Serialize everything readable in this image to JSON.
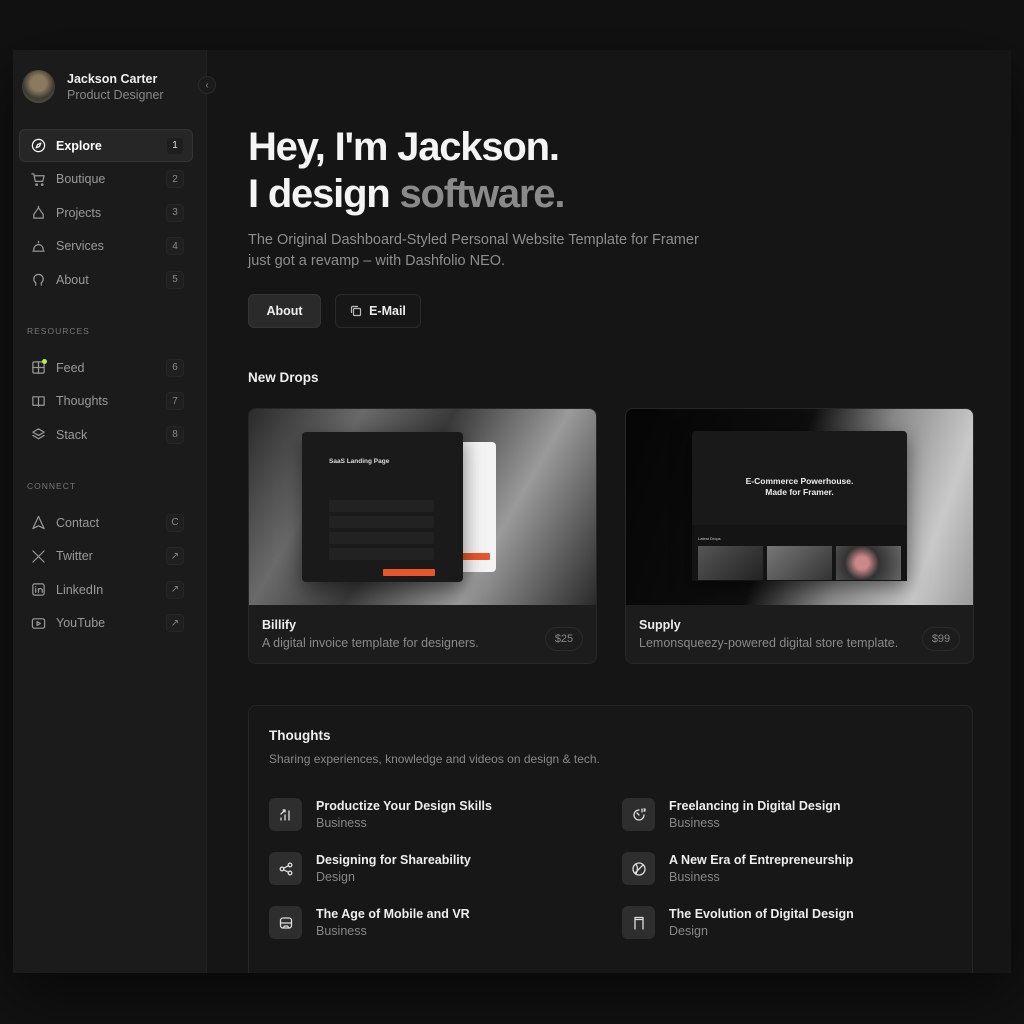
{
  "profile": {
    "name": "Jackson Carter",
    "role": "Product Designer"
  },
  "nav": [
    {
      "label": "Explore",
      "key": "1",
      "icon": "compass-icon",
      "active": true
    },
    {
      "label": "Boutique",
      "key": "2",
      "icon": "cart-icon"
    },
    {
      "label": "Projects",
      "key": "3",
      "icon": "projects-icon"
    },
    {
      "label": "Services",
      "key": "4",
      "icon": "bell-icon"
    },
    {
      "label": "About",
      "key": "5",
      "icon": "about-icon"
    }
  ],
  "resources_label": "RESOURCES",
  "resources": [
    {
      "label": "Feed",
      "key": "6",
      "icon": "feed-icon"
    },
    {
      "label": "Thoughts",
      "key": "7",
      "icon": "book-icon"
    },
    {
      "label": "Stack",
      "key": "8",
      "icon": "layers-icon"
    }
  ],
  "connect_label": "CONNECT",
  "connect": [
    {
      "label": "Contact",
      "key": "C",
      "icon": "send-icon"
    },
    {
      "label": "Twitter",
      "key": "↗",
      "icon": "x-icon"
    },
    {
      "label": "LinkedIn",
      "key": "↗",
      "icon": "linkedin-icon"
    },
    {
      "label": "YouTube",
      "key": "↗",
      "icon": "youtube-icon"
    }
  ],
  "hero": {
    "line1": "Hey, I'm Jackson.",
    "line2a": "I design ",
    "line2b": "software.",
    "subtitle": "The Original Dashboard-Styled Personal Website Template for Framer just got a revamp – with Dashfolio NEO.",
    "about_btn": "About",
    "email_btn": "E-Mail"
  },
  "drops": {
    "title": "New Drops",
    "items": [
      {
        "title": "Billify",
        "desc": "A digital invoice template for designers.",
        "price": "$25",
        "mock_title": "SaaS Landing Page"
      },
      {
        "title": "Supply",
        "desc": "Lemonsqueezy-powered digital store template.",
        "price": "$99",
        "mock_title1": "E-Commerce Powerhouse.",
        "mock_title2": "Made for Framer.",
        "mock_section": "Latest Drops"
      }
    ]
  },
  "thoughts": {
    "title": "Thoughts",
    "subtitle": "Sharing experiences, knowledge and videos on design & tech.",
    "items": [
      {
        "title": "Productize Your Design Skills",
        "category": "Business",
        "icon": "chart-icon"
      },
      {
        "title": "Freelancing in Digital Design",
        "category": "Business",
        "icon": "timer-icon"
      },
      {
        "title": "Designing for Shareability",
        "category": "Design",
        "icon": "share-icon"
      },
      {
        "title": "A New Era of Entrepreneurship",
        "category": "Business",
        "icon": "ball-icon"
      },
      {
        "title": "The Age of Mobile and VR",
        "category": "Business",
        "icon": "vr-icon"
      },
      {
        "title": "The Evolution of Digital Design",
        "category": "Design",
        "icon": "phone-icon"
      }
    ]
  },
  "colors": {
    "accent": "#e8572a",
    "feed_dot": "#b6f23a"
  }
}
